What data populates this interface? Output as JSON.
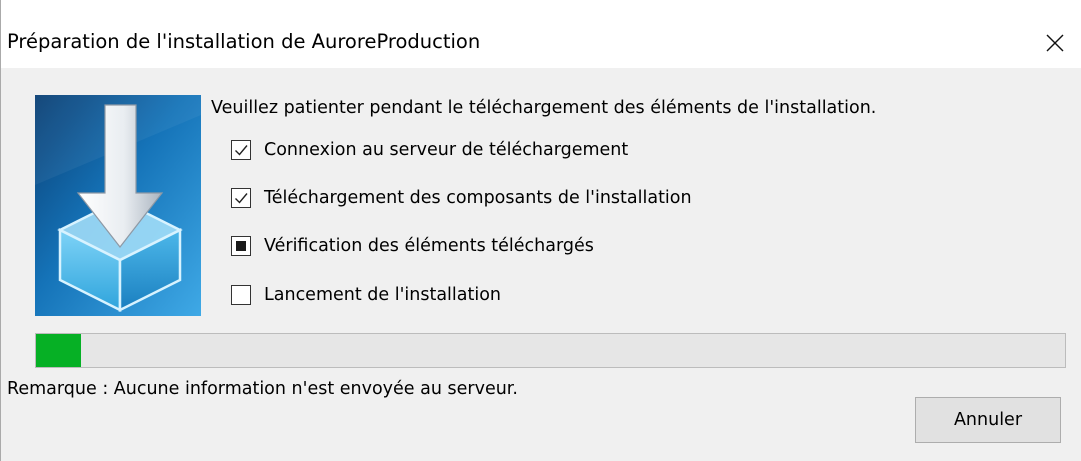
{
  "window": {
    "title": "Préparation de l'installation de AuroreProduction",
    "close_icon": "close-icon"
  },
  "banner": {
    "icon": "download-box-icon"
  },
  "main": {
    "intro": "Veuillez patienter pendant le téléchargement des éléments de l'installation.",
    "steps": [
      {
        "label": "Connexion au serveur de téléchargement",
        "state": "done"
      },
      {
        "label": "Téléchargement des composants de l'installation",
        "state": "done"
      },
      {
        "label": "Vérification des éléments téléchargés",
        "state": "in-progress"
      },
      {
        "label": "Lancement de l'installation",
        "state": "pending"
      }
    ]
  },
  "progress": {
    "percent": 4.4,
    "color": "#06b025"
  },
  "footer": {
    "note": "Remarque : Aucune information n'est envoyée au serveur.",
    "cancel_label": "Annuler"
  }
}
